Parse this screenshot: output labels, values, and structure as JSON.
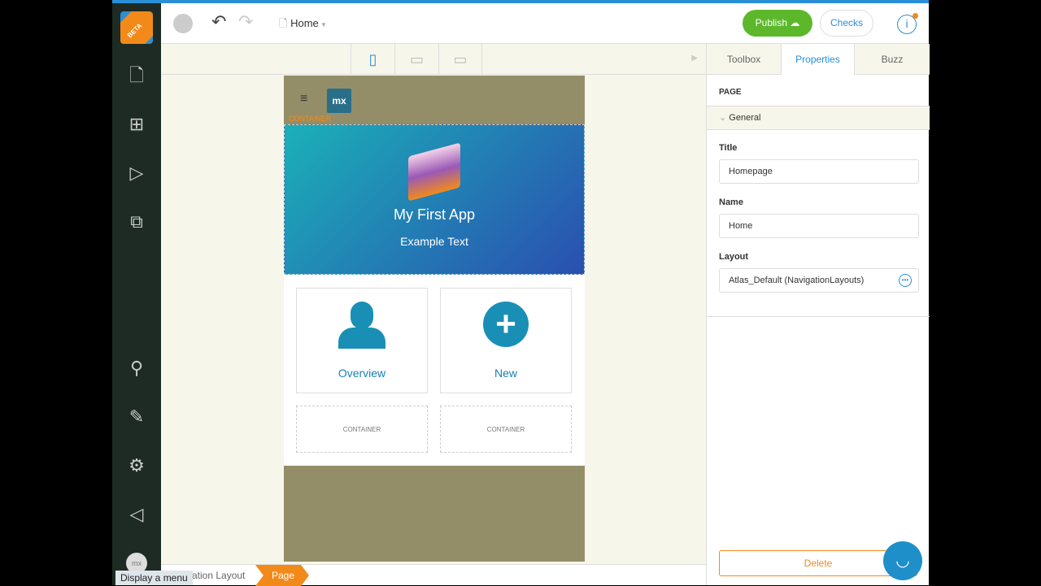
{
  "sidebar": {
    "logo": "mx",
    "beta": "BETA",
    "items": [
      "page-icon",
      "app-structure-icon",
      "play-icon",
      "pages-icon",
      "search-icon",
      "brush-icon",
      "gear-icon",
      "megaphone-icon"
    ],
    "avatar": "mx",
    "tooltip": "Display a menu"
  },
  "toolbar": {
    "page": "Home",
    "publish": "Publish",
    "checks": "Checks"
  },
  "phone": {
    "container_label": "CONTAINER",
    "logo": "mx",
    "title": "My First App",
    "subtitle": "Example Text",
    "tiles": [
      {
        "label": "Overview"
      },
      {
        "label": "New"
      }
    ],
    "containers": [
      "CONTAINER",
      "CONTAINER"
    ]
  },
  "panel": {
    "tabs": [
      "Toolbox",
      "Properties",
      "Buzz"
    ],
    "section": "PAGE",
    "group": "General",
    "fields": [
      {
        "label": "Title",
        "value": "Homepage"
      },
      {
        "label": "Name",
        "value": "Home"
      },
      {
        "label": "Layout",
        "value": "Atlas_Default (NavigationLayouts)"
      }
    ],
    "delete": "Delete"
  },
  "breadcrumb": {
    "items": [
      "ation Layout",
      "Page"
    ]
  },
  "colors": {
    "accent": "#2a8fd6",
    "publish": "#5cb82a",
    "orange": "#f28a1a"
  }
}
